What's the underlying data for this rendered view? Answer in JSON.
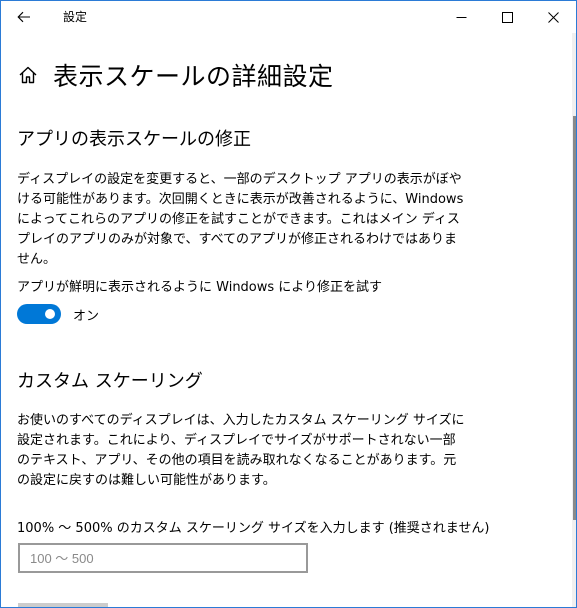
{
  "window": {
    "title": "設定",
    "accent_color": "#0078d7",
    "border_color": "#2b7bd6"
  },
  "titlebar": {
    "back_icon": "back-arrow-icon",
    "minimize_icon": "minimize-icon",
    "maximize_icon": "maximize-icon",
    "close_icon": "close-icon"
  },
  "page": {
    "home_icon": "home-icon",
    "title": "表示スケールの詳細設定"
  },
  "fix_section": {
    "title": "アプリの表示スケールの修正",
    "description": "ディスプレイの設定を変更すると、一部のデスクトップ アプリの表示がぼやける可能性があります。次回開くときに表示が改善されるように、Windows によってこれらのアプリの修正を試すことができます。これはメイン ディスプレイのアプリのみが対象で、すべてのアプリが修正されるわけではありません。",
    "toggle_label": "アプリが鮮明に表示されるように Windows により修正を試す",
    "toggle_state": "オン",
    "toggle_on": true
  },
  "custom_section": {
    "title": "カスタム スケーリング",
    "description": "お使いのすべてのディスプレイは、入力したカスタム スケーリング サイズに設定されます。これにより、ディスプレイでサイズがサポートされない一部のテキスト、アプリ、その他の項目を読み取れなくなることがあります。元の設定に戻すのは難しい可能性があります。",
    "input_label": "100% 〜 500% のカスタム スケーリング サイズを入力します (推奨されません)",
    "input_placeholder": "100 〜 500",
    "input_value": ""
  }
}
